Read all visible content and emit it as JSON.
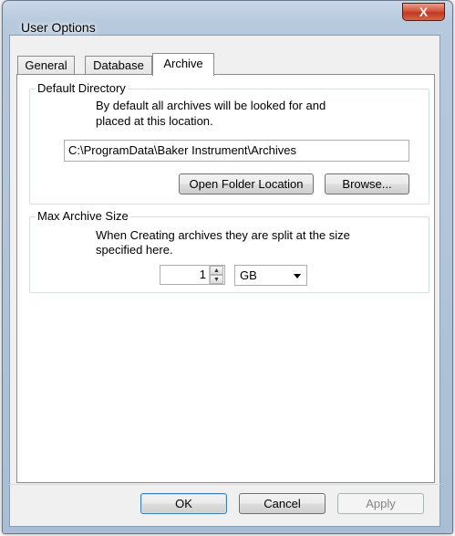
{
  "window": {
    "title": "User Options",
    "close_glyph": "X"
  },
  "tabs": [
    {
      "label": "General",
      "active": false
    },
    {
      "label": "Database",
      "active": false
    },
    {
      "label": "Archive",
      "active": true
    }
  ],
  "default_directory": {
    "group_title": "Default Directory",
    "description_line1": "By default all archives will be looked for and",
    "description_line2": "placed at this location.",
    "path_value": "C:\\ProgramData\\Baker Instrument\\Archives",
    "open_folder_label": "Open Folder Location",
    "browse_label": "Browse..."
  },
  "max_archive_size": {
    "group_title": "Max Archive Size",
    "description_line1": "When Creating archives they are split at the size",
    "description_line2": "specified here.",
    "size_value": "1",
    "unit_selected": "GB"
  },
  "footer": {
    "ok_label": "OK",
    "cancel_label": "Cancel",
    "apply_label": "Apply",
    "apply_enabled": false
  },
  "icons": {
    "close": "close-icon",
    "spin_up": "spin-up-icon",
    "spin_down": "spin-down-icon",
    "combo_arrow": "chevron-down-icon"
  }
}
